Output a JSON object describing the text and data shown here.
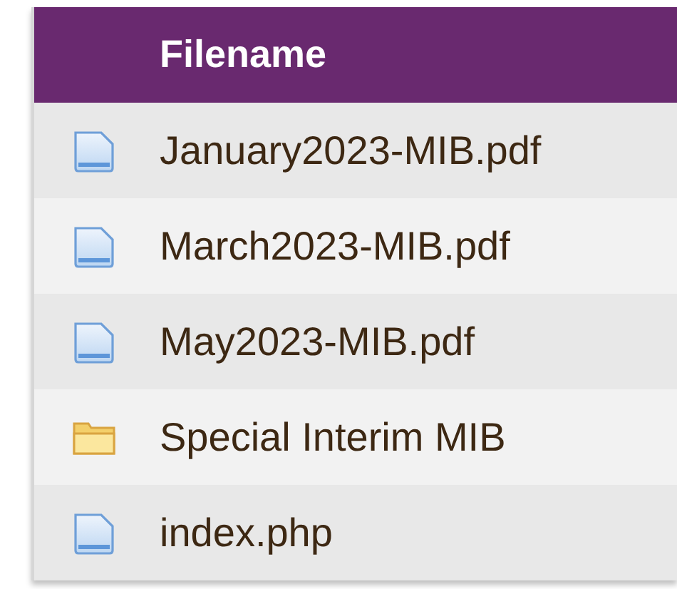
{
  "table": {
    "columns": [
      "Filename"
    ],
    "rows": [
      {
        "kind": "file",
        "name": "January2023-MIB.pdf"
      },
      {
        "kind": "file",
        "name": "March2023-MIB.pdf"
      },
      {
        "kind": "file",
        "name": "May2023-MIB.pdf"
      },
      {
        "kind": "folder",
        "name": "Special Interim MIB"
      },
      {
        "kind": "file",
        "name": "index.php"
      }
    ]
  }
}
